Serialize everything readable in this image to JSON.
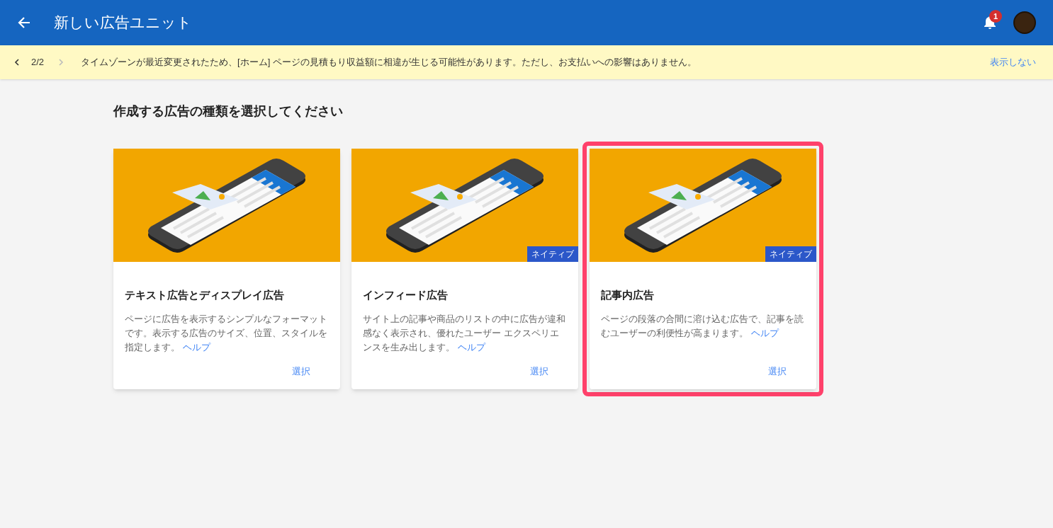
{
  "app_bar": {
    "title": "新しい広告ユニット",
    "notification_count": "1"
  },
  "banner": {
    "pager": "2/2",
    "message": "タイムゾーンが最近変更されたため、[ホーム] ページの見積もり収益額に相違が生じる可能性があります。ただし、お支払いへの影響はありません。",
    "dismiss": "表示しない"
  },
  "heading": "作成する広告の種類を選択してください",
  "cards": [
    {
      "title": "テキスト広告とディスプレイ広告",
      "description": "ページに広告を表示するシンプルなフォーマットです。表示する広告のサイズ、位置、スタイルを指定します。",
      "help_link": "ヘルプ",
      "action": "選択",
      "highlighted": false
    },
    {
      "title": "インフィード広告",
      "badge": "ネイティブ",
      "description": "サイト上の記事や商品のリストの中に広告が違和感なく表示され、優れたユーザー エクスペリエンスを生み出します。",
      "help_link": "ヘルプ",
      "action": "選択",
      "highlighted": false
    },
    {
      "title": "記事内広告",
      "badge": "ネイティブ",
      "description": "ページの段落の合間に溶け込む広告で、記事を読むユーザーの利便性が高まります。",
      "help_link": "ヘルプ",
      "action": "選択",
      "highlighted": true
    }
  ]
}
